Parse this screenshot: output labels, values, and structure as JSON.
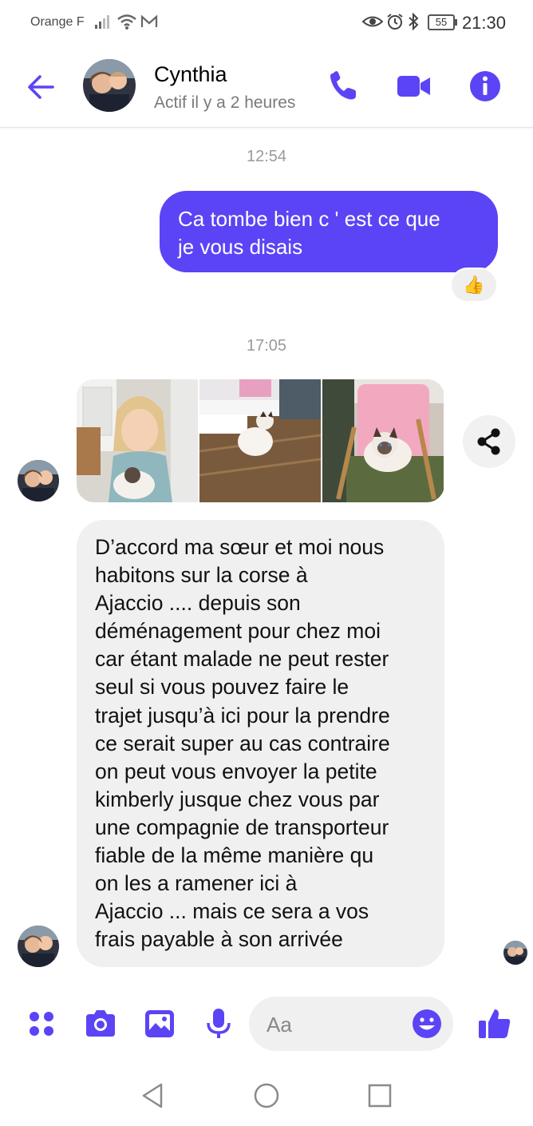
{
  "status_bar": {
    "carrier": "Orange F",
    "battery": "55",
    "time": "21:30"
  },
  "header": {
    "contact_name": "Cynthia",
    "presence": "Actif il y a 2 heures"
  },
  "conversation": {
    "timestamp_1": "12:54",
    "outgoing_message": "Ca tombe bien c ' est ce que\nje  vous disais",
    "reaction_emoji": "👍",
    "timestamp_2": "17:05",
    "incoming_message": "D’accord ma sœur et moi nous\nhabitons sur la corse à\nAjaccio .... depuis son\ndéménagement pour chez moi\ncar étant malade ne peut rester\nseul si vous pouvez faire le\ntrajet jusqu’à ici pour la prendre\nce serait super au cas contraire\non peut vous envoyer la petite\nkimberly jusque chez vous par\nune compagnie de transporteur\nfiable de la même manière qu\non les a ramener ici à\nAjaccio ...  mais ce sera a vos\nfrais payable à son arrivée"
  },
  "composer": {
    "placeholder": "Aa"
  },
  "colors": {
    "accent": "#5b44f5",
    "incoming_bubble": "#f0f0f0",
    "timestamp": "#9a9a9a"
  },
  "icons": {
    "header": [
      "back-arrow-icon",
      "phone-icon",
      "video-camera-icon",
      "info-icon"
    ],
    "composer": [
      "apps-icon",
      "camera-icon",
      "gallery-icon",
      "microphone-icon",
      "emoji-icon",
      "thumbs-up-icon"
    ],
    "navigation": [
      "nav-back-icon",
      "nav-home-icon",
      "nav-recents-icon"
    ]
  }
}
